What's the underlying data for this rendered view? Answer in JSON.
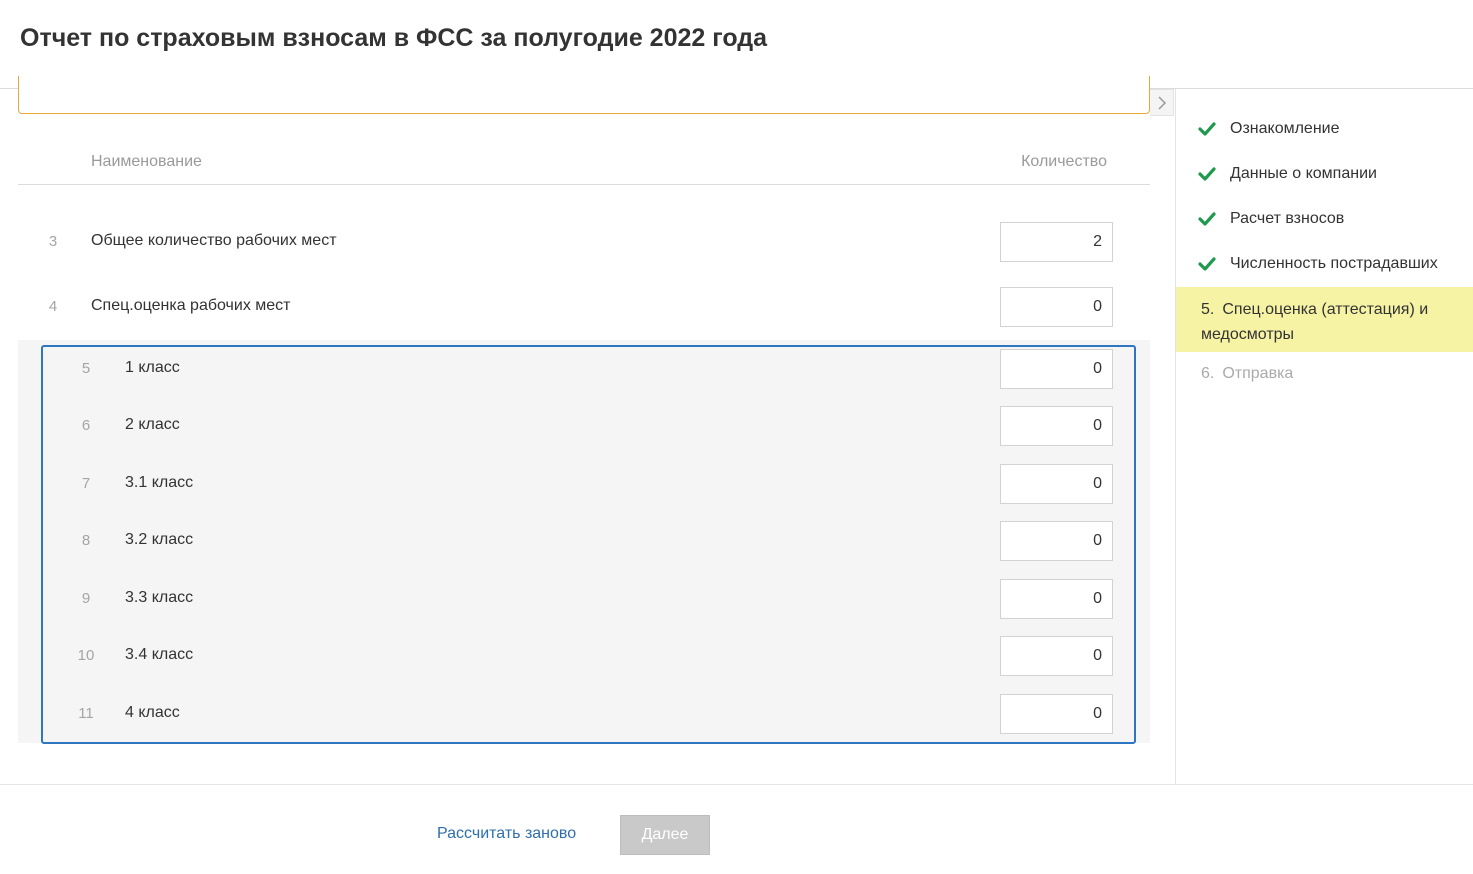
{
  "header": {
    "title": "Отчет по страховым взносам в ФСС за полугодие 2022 года"
  },
  "table": {
    "col_name": "Наименование",
    "col_qty": "Количество",
    "rows": [
      {
        "num": "3",
        "label": "Общее количество рабочих мест",
        "value": "2"
      },
      {
        "num": "4",
        "label": "Спец.оценка рабочих мест",
        "value": "0"
      },
      {
        "num": "5",
        "label": "1 класс",
        "value": "0"
      },
      {
        "num": "6",
        "label": "2 класс",
        "value": "0"
      },
      {
        "num": "7",
        "label": "3.1 класс",
        "value": "0"
      },
      {
        "num": "8",
        "label": "3.2 класс",
        "value": "0"
      },
      {
        "num": "9",
        "label": "3.3 класс",
        "value": "0"
      },
      {
        "num": "10",
        "label": "3.4 класс",
        "value": "0"
      },
      {
        "num": "11",
        "label": "4 класс",
        "value": "0"
      }
    ]
  },
  "steps": [
    {
      "label": "Ознакомление",
      "status": "done",
      "icon": "check-icon"
    },
    {
      "label": "Данные о компании",
      "status": "done",
      "icon": "check-icon"
    },
    {
      "label": "Расчет взносов",
      "status": "done",
      "icon": "check-icon"
    },
    {
      "label": "Численность пострадавших",
      "status": "done",
      "icon": "check-icon"
    },
    {
      "num": "5.",
      "label": "Спец.оценка (аттестация) и медосмотры",
      "status": "active"
    },
    {
      "num": "6.",
      "label": "Отправка",
      "status": "pending"
    }
  ],
  "footer": {
    "recalc_label": "Рассчитать заново",
    "next_label": "Далее"
  },
  "icons": {
    "collapse_toggle": "chevron-right-icon"
  },
  "colors": {
    "accent": "#2e76bf",
    "check": "#1f9a4c",
    "active_step": "#f6f3a5",
    "notice_border": "#e8a838",
    "link": "#2e6fad",
    "disabled_button": "#c9c9c9"
  }
}
